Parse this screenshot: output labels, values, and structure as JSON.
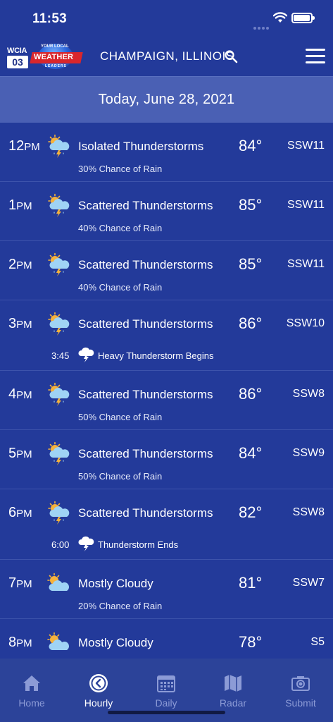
{
  "status_bar": {
    "time": "11:53"
  },
  "header": {
    "logo_text_wcia": "WCIA",
    "logo_text_channel": "03",
    "logo_text_small": "YOUR LOCAL",
    "logo_text_weather": "WEATHER",
    "logo_text_leaders": "LEADERS",
    "location": "CHAMPAIGN, ILLINOIS"
  },
  "date_bar": {
    "label": "Today, June 28, 2021"
  },
  "hours": [
    {
      "hour": "12",
      "ampm": "PM",
      "icon": "thunderstorm-icon",
      "condition": "Isolated Thunderstorms",
      "temp": "84°",
      "wind": "SSW11",
      "sub": "30% Chance of Rain"
    },
    {
      "hour": "1",
      "ampm": "PM",
      "icon": "thunderstorm-icon",
      "condition": "Scattered Thunderstorms",
      "temp": "85°",
      "wind": "SSW11",
      "sub": "40% Chance of Rain"
    },
    {
      "hour": "2",
      "ampm": "PM",
      "icon": "thunderstorm-icon",
      "condition": "Scattered Thunderstorms",
      "temp": "85°",
      "wind": "SSW11",
      "sub": "40% Chance of Rain"
    },
    {
      "hour": "3",
      "ampm": "PM",
      "icon": "thunderstorm-icon",
      "condition": "Scattered Thunderstorms",
      "temp": "86°",
      "wind": "SSW10",
      "alert_time": "3:45",
      "alert_text": "Heavy Thunderstorm Begins"
    },
    {
      "hour": "4",
      "ampm": "PM",
      "icon": "thunderstorm-icon",
      "condition": "Scattered Thunderstorms",
      "temp": "86°",
      "wind": "SSW8",
      "sub": "50% Chance of Rain"
    },
    {
      "hour": "5",
      "ampm": "PM",
      "icon": "thunderstorm-icon",
      "condition": "Scattered Thunderstorms",
      "temp": "84°",
      "wind": "SSW9",
      "sub": "50% Chance of Rain"
    },
    {
      "hour": "6",
      "ampm": "PM",
      "icon": "thunderstorm-icon",
      "condition": "Scattered Thunderstorms",
      "temp": "82°",
      "wind": "SSW8",
      "alert_time": "6:00",
      "alert_text": "Thunderstorm Ends"
    },
    {
      "hour": "7",
      "ampm": "PM",
      "icon": "mostly-cloudy-icon",
      "condition": "Mostly Cloudy",
      "temp": "81°",
      "wind": "SSW7",
      "sub": "20% Chance of Rain"
    },
    {
      "hour": "8",
      "ampm": "PM",
      "icon": "mostly-cloudy-icon",
      "condition": "Mostly Cloudy",
      "temp": "78°",
      "wind": "S5",
      "sub": ""
    }
  ],
  "tabs": [
    {
      "label": "Home",
      "icon": "home-icon",
      "active": false
    },
    {
      "label": "Hourly",
      "icon": "clock-icon",
      "active": true
    },
    {
      "label": "Daily",
      "icon": "calendar-icon",
      "active": false
    },
    {
      "label": "Radar",
      "icon": "map-icon",
      "active": false
    },
    {
      "label": "Submit",
      "icon": "camera-icon",
      "active": false
    }
  ],
  "colors": {
    "background": "#233a9a",
    "date_bar": "#4a60b4",
    "tab_bar": "#2c4399",
    "tab_inactive": "#8c9bd6"
  }
}
